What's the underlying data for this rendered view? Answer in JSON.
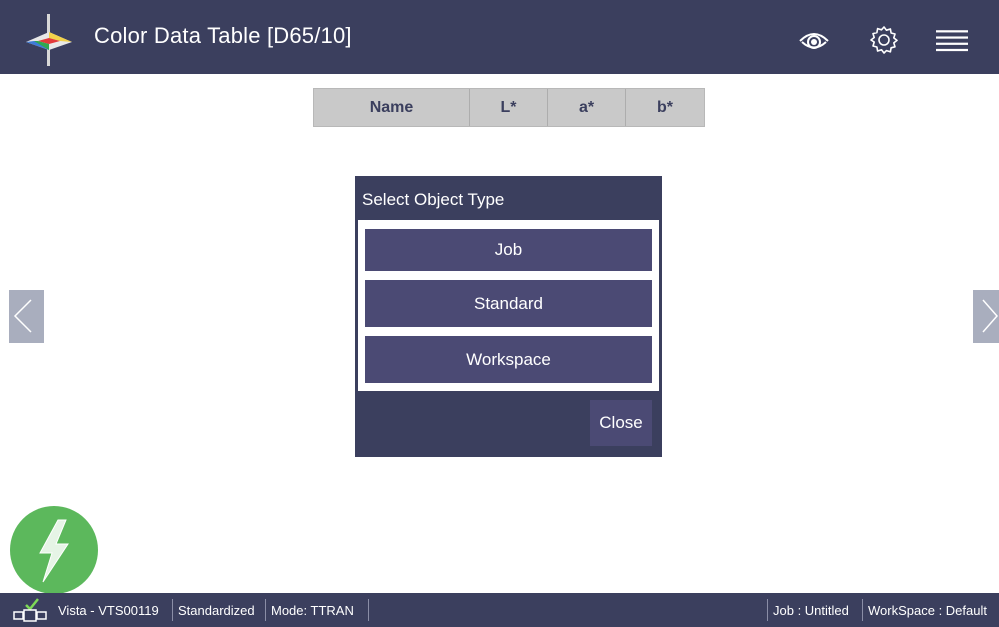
{
  "header": {
    "title": "Color Data Table [D65/10]",
    "icons": [
      "prism-logo-icon",
      "eye-icon",
      "gear-icon",
      "hamburger-menu-icon"
    ]
  },
  "table": {
    "columns": [
      "Name",
      "L*",
      "a*",
      "b*"
    ]
  },
  "dialog": {
    "title": "Select Object Type",
    "options": [
      "Job",
      "Standard",
      "Workspace"
    ],
    "close_label": "Close"
  },
  "status_bar": {
    "device": "Vista - VTS00119",
    "state": "Standardized",
    "mode": "Mode: TTRAN",
    "job": "Job : Untitled",
    "workspace": "WorkSpace : Default"
  },
  "colors": {
    "header_bg": "#3b3f5e",
    "button_bg": "#4b4a74",
    "fab_green": "#5cb85c",
    "table_header_bg": "#c9c9c9"
  }
}
